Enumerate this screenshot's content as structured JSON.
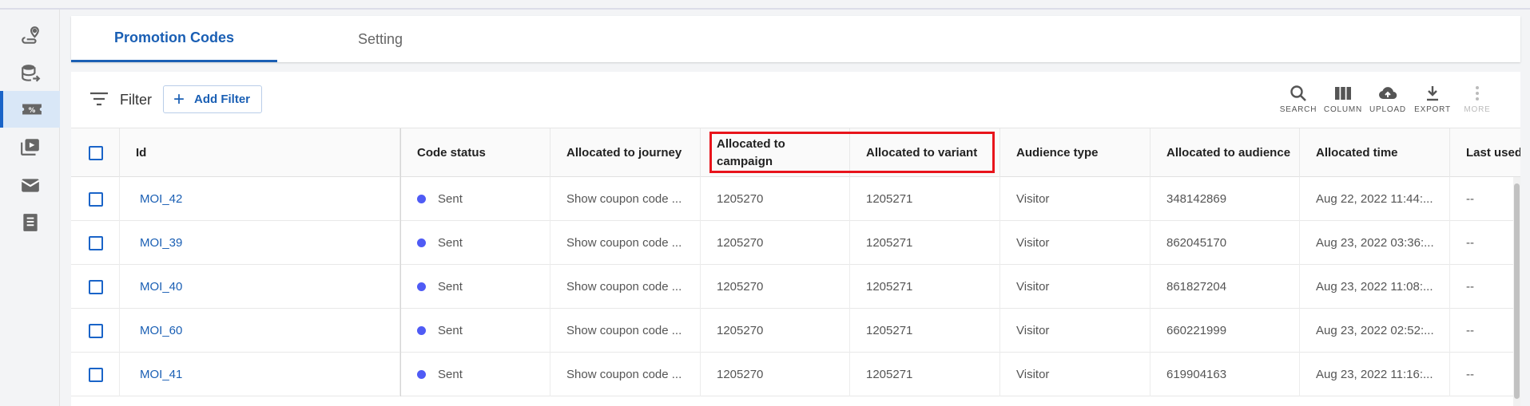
{
  "sidebar": {
    "items": [
      {
        "icon": "route-pin-icon"
      },
      {
        "icon": "database-arrow-icon"
      },
      {
        "icon": "coupon-ticket-icon",
        "active": true
      },
      {
        "icon": "video-library-icon"
      },
      {
        "icon": "mail-icon"
      },
      {
        "icon": "receipt-icon"
      }
    ]
  },
  "tabs": [
    {
      "label": "Promotion Codes",
      "active": true
    },
    {
      "label": "Setting",
      "active": false
    }
  ],
  "filter": {
    "label": "Filter",
    "add_filter_label": "Add Filter"
  },
  "toolbar": {
    "search": "SEARCH",
    "column": "COLUMN",
    "upload": "UPLOAD",
    "export": "EXPORT",
    "more": "MORE"
  },
  "table": {
    "headers": {
      "id": "Id",
      "code_status": "Code status",
      "journey": "Allocated to journey",
      "campaign": "Allocated to campaign",
      "variant": "Allocated to variant",
      "audience_type": "Audience type",
      "audience": "Allocated to audience",
      "time": "Allocated time",
      "last_used": "Last used"
    },
    "rows": [
      {
        "id": "MOI_42",
        "status": "Sent",
        "journey": "Show coupon code ...",
        "campaign": "1205270",
        "variant": "1205271",
        "audience_type": "Visitor",
        "audience": "348142869",
        "time": "Aug 22, 2022 11:44:...",
        "last_used": "--"
      },
      {
        "id": "MOI_39",
        "status": "Sent",
        "journey": "Show coupon code ...",
        "campaign": "1205270",
        "variant": "1205271",
        "audience_type": "Visitor",
        "audience": "862045170",
        "time": "Aug 23, 2022 03:36:...",
        "last_used": "--"
      },
      {
        "id": "MOI_40",
        "status": "Sent",
        "journey": "Show coupon code ...",
        "campaign": "1205270",
        "variant": "1205271",
        "audience_type": "Visitor",
        "audience": "861827204",
        "time": "Aug 23, 2022 11:08:...",
        "last_used": "--"
      },
      {
        "id": "MOI_60",
        "status": "Sent",
        "journey": "Show coupon code ...",
        "campaign": "1205270",
        "variant": "1205271",
        "audience_type": "Visitor",
        "audience": "660221999",
        "time": "Aug 23, 2022 02:52:...",
        "last_used": "--"
      },
      {
        "id": "MOI_41",
        "status": "Sent",
        "journey": "Show coupon code ...",
        "campaign": "1205270",
        "variant": "1205271",
        "audience_type": "Visitor",
        "audience": "619904163",
        "time": "Aug 23, 2022 11:16:...",
        "last_used": "--"
      }
    ]
  },
  "colors": {
    "accent": "#1a5fb4",
    "status_sent": "#4f5bf5",
    "highlight": "#e8141b"
  }
}
